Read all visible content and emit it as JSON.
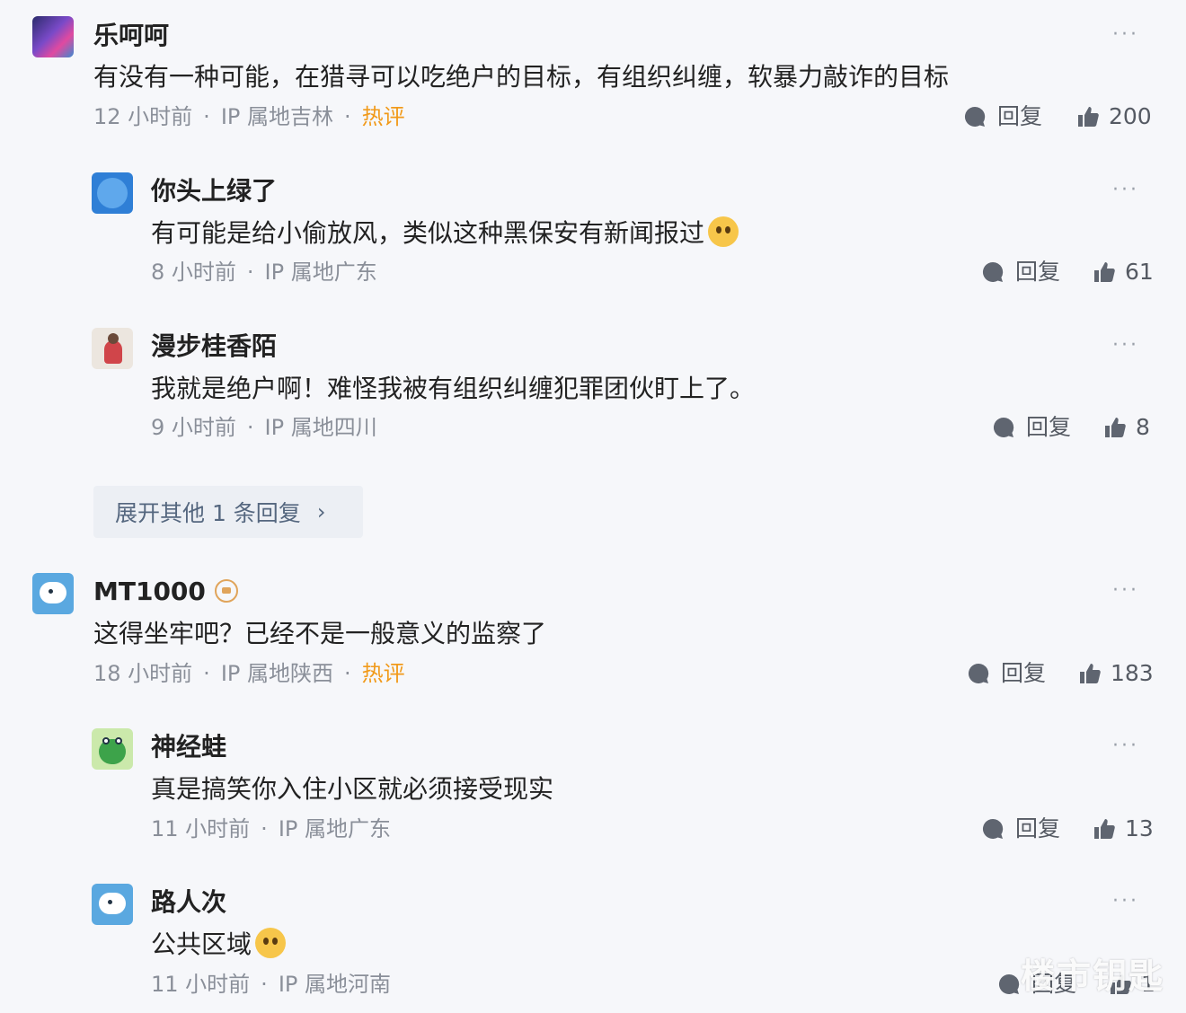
{
  "reply_label": "回复",
  "more_label": "···",
  "expand": {
    "label": "展开其他 1 条回复",
    "chevron": "›"
  },
  "watermark": "楼市钥匙",
  "comments": [
    {
      "name": "乐呵呵",
      "text": "有没有一种可能，在猎寻可以吃绝户的目标，有组织纠缠，软暴力敲诈的目标",
      "time": "12 小时前",
      "ip": "IP 属地吉林",
      "hot": "热评",
      "likes": "200",
      "avatar_colors": [
        "#3b2a6b",
        "#c84aa0"
      ]
    },
    {
      "name": "你头上绿了",
      "text": "有可能是给小偷放风，类似这种黑保安有新闻报过",
      "time": "8 小时前",
      "ip": "IP 属地广东",
      "likes": "61",
      "avatar_colors": [
        "#2f7fd6",
        "#6fb2f0"
      ]
    },
    {
      "name": "漫步桂香陌",
      "text": "我就是绝户啊！难怪我被有组织纠缠犯罪团伙盯上了。",
      "time": "9 小时前",
      "ip": "IP 属地四川",
      "likes": "8",
      "avatar_colors": [
        "#e9e3dd",
        "#d0454a"
      ]
    },
    {
      "name": "MT1000",
      "text": "这得坐牢吧？已经不是一般意义的监察了",
      "time": "18 小时前",
      "ip": "IP 属地陕西",
      "hot": "热评",
      "likes": "183",
      "avatar_colors": [
        "#5aa8e0",
        "#ffffff"
      ]
    },
    {
      "name": "神经蛙",
      "text": "真是搞笑你入住小区就必须接受现实",
      "time": "11 小时前",
      "ip": "IP 属地广东",
      "likes": "13",
      "avatar_colors": [
        "#c7e8a6",
        "#3da34a"
      ]
    },
    {
      "name": "路人次",
      "text": "公共区域",
      "time": "11 小时前",
      "ip": "IP 属地河南",
      "likes": "1",
      "avatar_colors": [
        "#5aa8e0",
        "#ffffff"
      ]
    }
  ]
}
